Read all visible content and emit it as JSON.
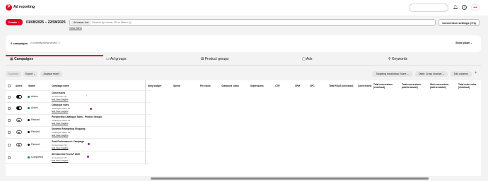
{
  "header": {
    "logo_glyph": "P",
    "title": "Ad reporting",
    "title_chevron": "⌄",
    "avatar": "•••"
  },
  "controls": {
    "create_label": "Create ⌄",
    "date_range": "01/08/2025 – 22/08/2025",
    "chip_label": "Ad name: Ind",
    "filter_placeholder": "Search by name, ID or filters (/)",
    "clear_filters": "Clear filters",
    "conversion_settings": "Conversion settings (7/1)"
  },
  "summary": {
    "campaign_count": "6 campaigns",
    "served_text": "2 currently being served ⓘ",
    "show_graph": "Show graph ⌄"
  },
  "tabs": [
    "Campaigns",
    "Ad groups",
    "Product groups",
    "Ads",
    "Keywords"
  ],
  "toolbar": {
    "duplicate": "Duplicate",
    "export": "Export ⌄",
    "analyse": "Analyse reach",
    "targeting": "Targeting breakdown: None ⌄",
    "table": "Table: Cross channel ⌄",
    "edit_columns": "Edit columns",
    "plus": "+"
  },
  "table": {
    "headers": {
      "active": "Active",
      "status": "Status",
      "campaign_name": "Campaign name",
      "daily_budget": "Daily budget",
      "spend": "Spend",
      "pin_clicks": "Pin clicks",
      "outbound_clicks": "Outbound clicks",
      "impressions": "Impressions",
      "ctr": "CTR",
      "cpm": "CPM",
      "cpc": "CPC",
      "roas": "Total ROAS (checkout)",
      "conversions": "Conversions",
      "total_conv_checkout": "Total conversions (checkout)",
      "total_conv_basket": "Total conversions (add to basket)",
      "web_conv_basket": "Web conversions (add to basket)",
      "total_order_value": "Total order value (checkout)"
    },
    "rows": [
      {
        "active": true,
        "status": "Active",
        "status_color": "#1a7f37",
        "name": "Conversions",
        "sub": "Conversions: ID",
        "links": "Edit  View insights"
      },
      {
        "active": true,
        "status": "Active",
        "status_color": "#1a7f37",
        "name": "Catalogue sales",
        "sub": "Catalogue sales: ID",
        "links": "Edit  View insights"
      },
      {
        "active": false,
        "status": "Paused",
        "status_color": "#111111",
        "name": "Prospecting Catalogue Sales - Product Groups",
        "sub": "Catalogue sales: ID",
        "links": "Edit  View insights"
      },
      {
        "active": false,
        "status": "Paused",
        "status_color": "#111111",
        "name": "Dynamic Retargeting Shopping",
        "sub": "Catalogue sales: ID",
        "links": "Edit  View insights"
      },
      {
        "active": false,
        "status": "Paused",
        "status_color": "#111111",
        "name": "Peak Performance+ Campaign",
        "sub": "Conversions: ID",
        "links": "Edit  View insights"
      },
      {
        "active": null,
        "status": "Completed",
        "status_color": "#1a7f37",
        "name": "8/8 Canceled Test AP 2025",
        "sub": "Conversions: ID",
        "links": "Edit  View insights"
      }
    ]
  },
  "colors": {
    "brand": "#e60023",
    "badge": "#9b1f8a",
    "active": "#1a7f37"
  }
}
